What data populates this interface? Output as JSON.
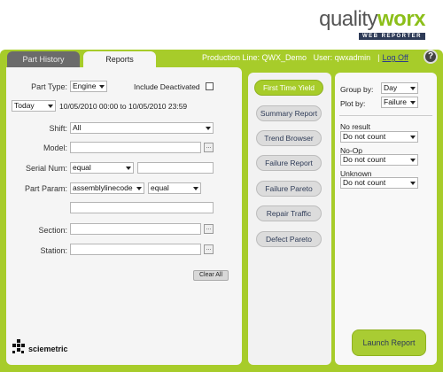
{
  "header": {
    "logo_main_1": "quality",
    "logo_main_2": "worx",
    "logo_sub": "WEB REPORTER",
    "production_line": "Production Line: QWX_Demo",
    "user": "User: qwxadmin",
    "separator": "|",
    "log_off": "Log Off",
    "help_label": "?"
  },
  "tabs": {
    "part_history": "Part History",
    "reports": "Reports"
  },
  "filters": {
    "part_type_label": "Part Type:",
    "part_type_value": "Engine",
    "include_deactivated_label": "Include Deactivated",
    "date_range_value": "Today",
    "date_range_text": "10/05/2010 00:00 to 10/05/2010 23:59",
    "shift_label": "Shift:",
    "shift_value": "All",
    "model_label": "Model:",
    "serial_num_label": "Serial Num:",
    "serial_num_op": "equal",
    "part_param_label": "Part Param:",
    "part_param_value": "assemblylinecode",
    "part_param_op": "equal",
    "section_label": "Section:",
    "station_label": "Station:",
    "browse_label": "...",
    "clear_all": "Clear All"
  },
  "brand": {
    "name": "sciemetric"
  },
  "reports": [
    "First Time Yield",
    "Summary Report",
    "Trend Browser",
    "Failure Report",
    "Failure Pareto",
    "Repair Traffic",
    "Defect Pareto"
  ],
  "options": {
    "group_by_label": "Group by:",
    "group_by_value": "Day",
    "plot_by_label": "Plot by:",
    "plot_by_value": "Failure",
    "no_result_label": "No result",
    "no_result_value": "Do not count",
    "no_op_label": "No-Op",
    "no_op_value": "Do not count",
    "unknown_label": "Unknown",
    "unknown_value": "Do not count",
    "launch_report": "Launch Report"
  },
  "colors": {
    "accent_green": "#a7cc2a",
    "navy": "#2e3b57"
  }
}
